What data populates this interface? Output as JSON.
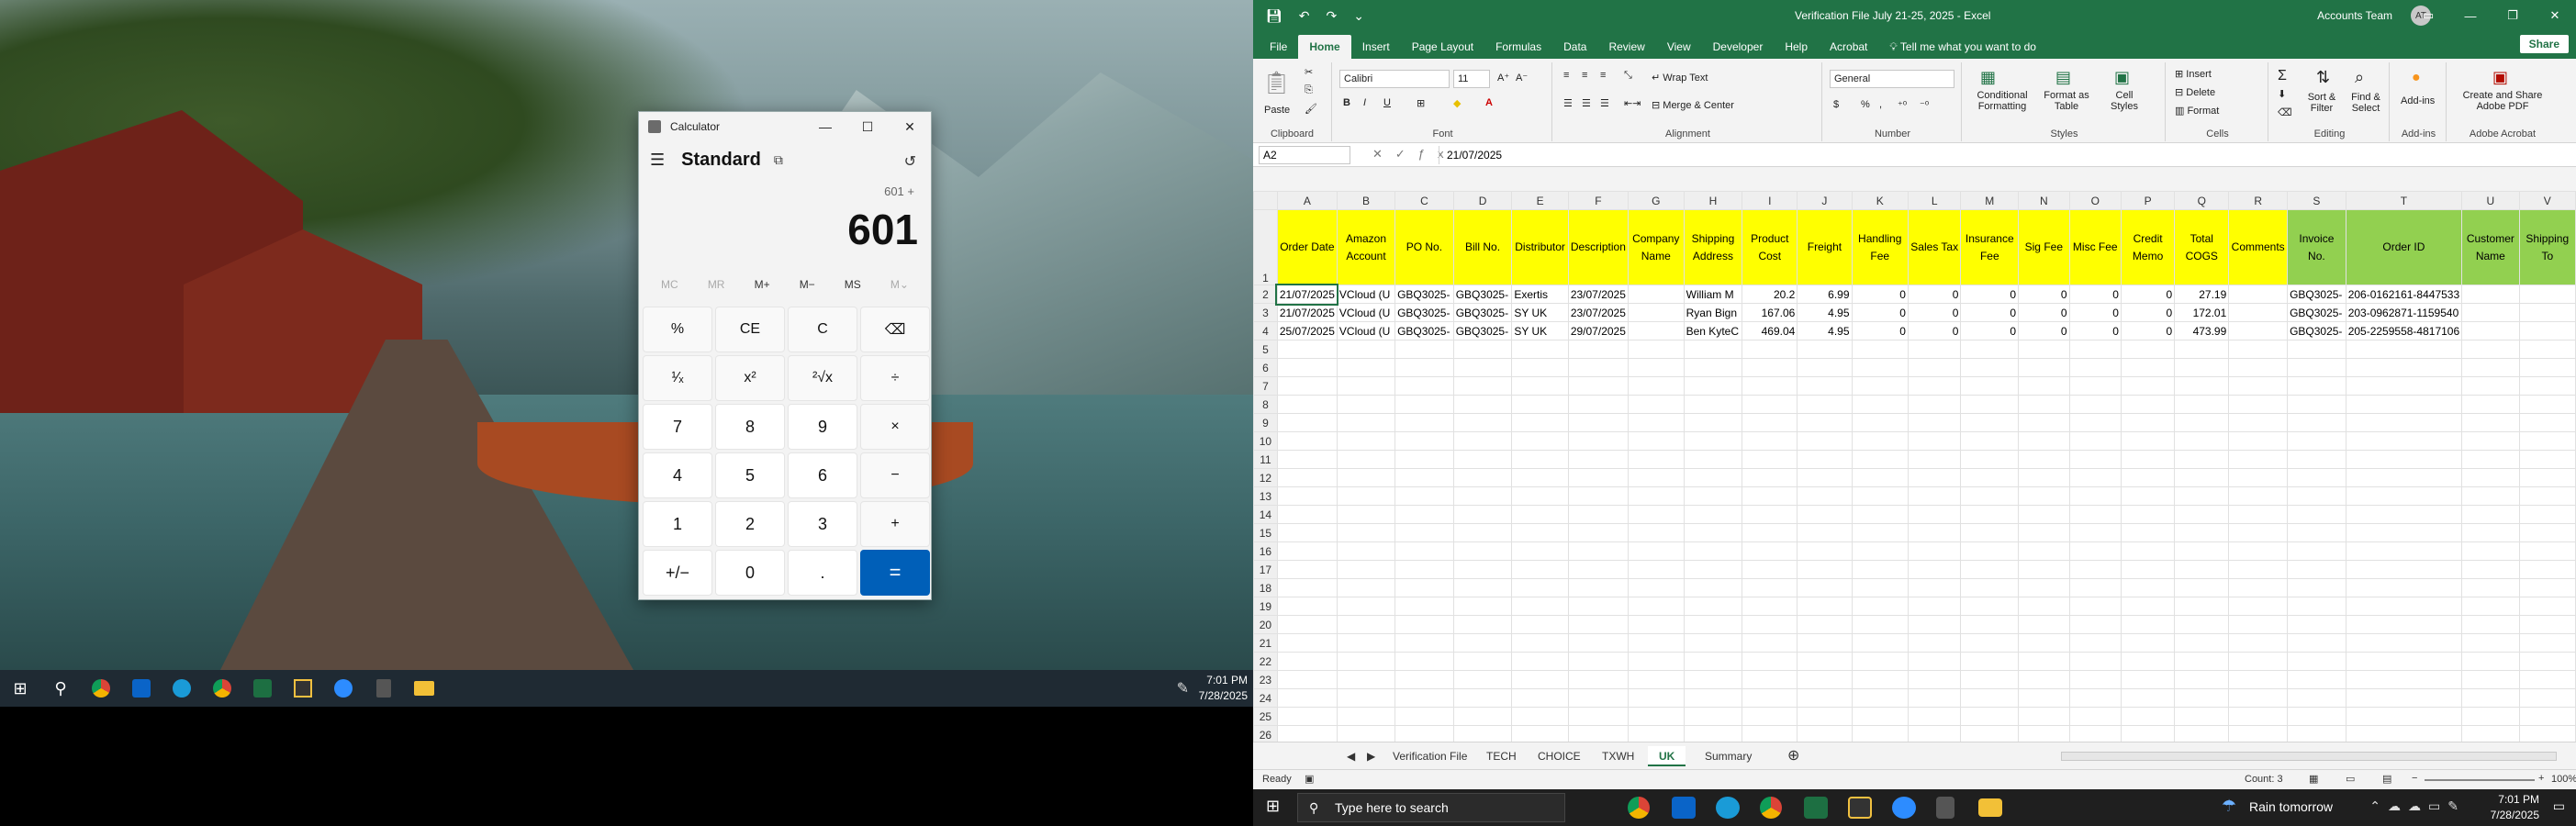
{
  "taskbar_left": {
    "time": "7:01 PM",
    "date": "7/28/2025"
  },
  "calculator": {
    "title": "Calculator",
    "mode": "Standard",
    "expression": "601 +",
    "display": "601",
    "memory": [
      "MC",
      "MR",
      "M+",
      "M−",
      "MS",
      "M⌄"
    ],
    "keys": [
      "%",
      "CE",
      "C",
      "⌫",
      "¹⁄ₓ",
      "x²",
      "²√x",
      "÷",
      "7",
      "8",
      "9",
      "×",
      "4",
      "5",
      "6",
      "−",
      "1",
      "2",
      "3",
      "+",
      "+/−",
      "0",
      ".",
      "="
    ]
  },
  "excel": {
    "doc_title": "Verification File July 21-25, 2025  -  Excel",
    "account": "Accounts Team",
    "avatar": "AT",
    "tabs": [
      "File",
      "Home",
      "Insert",
      "Page Layout",
      "Formulas",
      "Data",
      "Review",
      "View",
      "Developer",
      "Help",
      "Acrobat"
    ],
    "tell_me": "Tell me what you want to do",
    "share": "Share",
    "ribbon": {
      "paste": "Paste",
      "clipboard": "Clipboard",
      "font_name": "Calibri",
      "font_size": "11",
      "font": "Font",
      "wrap": "Wrap Text",
      "merge": "Merge & Center",
      "alignment": "Alignment",
      "number_format": "General",
      "number": "Number",
      "cond": "Conditional Formatting",
      "fmt_table": "Format as Table",
      "cell_styles": "Cell Styles",
      "styles": "Styles",
      "insert": "Insert",
      "delete": "Delete",
      "format": "Format",
      "cells": "Cells",
      "sort": "Sort & Filter",
      "find": "Find & Select",
      "editing": "Editing",
      "addins": "Add-ins",
      "addins_group": "Add-ins",
      "acrobat": "Create and Share Adobe PDF",
      "acrobat_group": "Adobe Acrobat"
    },
    "name_box": "A2",
    "formula": "21/07/2025",
    "columns": [
      "A",
      "B",
      "C",
      "D",
      "E",
      "F",
      "G",
      "H",
      "I",
      "J",
      "K",
      "L",
      "M",
      "N",
      "O",
      "P",
      "Q",
      "R",
      "S",
      "T",
      "U",
      "V"
    ],
    "headers": [
      "Order Date",
      "Amazon Account",
      "PO No.",
      "Bill No.",
      "Distributor",
      "Description",
      "Company Name",
      "Shipping Address",
      "Product Cost",
      "Freight",
      "Handling Fee",
      "Sales Tax",
      "Insurance Fee",
      "Sig Fee",
      "Misc Fee",
      "Credit Memo",
      "Total COGS",
      "Comments",
      "Invoice No.",
      "Order ID",
      "Customer Name",
      "Shipping To"
    ],
    "rows": [
      [
        "21/07/2025",
        "VCloud (U",
        "GBQ3025-",
        "GBQ3025-",
        "Exertis",
        "23/07/2025",
        "",
        "William M",
        "20.2",
        "6.99",
        "0",
        "0",
        "0",
        "0",
        "0",
        "0",
        "27.19",
        "",
        "GBQ3025-",
        "206-0162161-8447533",
        "",
        ""
      ],
      [
        "21/07/2025",
        "VCloud (U",
        "GBQ3025-",
        "GBQ3025-",
        "SY UK",
        "23/07/2025",
        "",
        "Ryan Bign",
        "167.06",
        "4.95",
        "0",
        "0",
        "0",
        "0",
        "0",
        "0",
        "172.01",
        "",
        "GBQ3025-",
        "203-0962871-1159540",
        "",
        ""
      ],
      [
        "25/07/2025",
        "VCloud (U",
        "GBQ3025-",
        "GBQ3025-",
        "SY UK",
        "29/07/2025",
        "",
        "Ben KyteC",
        "469.04",
        "4.95",
        "0",
        "0",
        "0",
        "0",
        "0",
        "0",
        "473.99",
        "",
        "GBQ3025-",
        "205-2259558-4817106",
        "",
        ""
      ]
    ],
    "row_numbers": [
      "1",
      "2",
      "3",
      "4",
      "5",
      "6",
      "7",
      "8",
      "9",
      "10",
      "11",
      "12",
      "13",
      "14",
      "15",
      "16",
      "17",
      "18",
      "19",
      "20",
      "21",
      "22",
      "23",
      "24",
      "25",
      "26"
    ],
    "sheets": [
      "Verification File",
      "TECH",
      "CHOICE",
      "TXWH",
      "UK",
      "Summary"
    ],
    "active_sheet": "UK",
    "status": "Ready",
    "count": "Count: 3",
    "zoom": "100%"
  },
  "taskbar_right": {
    "search": "Type here to search",
    "weather": "Rain tomorrow",
    "time": "7:01 PM",
    "date": "7/28/2025"
  }
}
